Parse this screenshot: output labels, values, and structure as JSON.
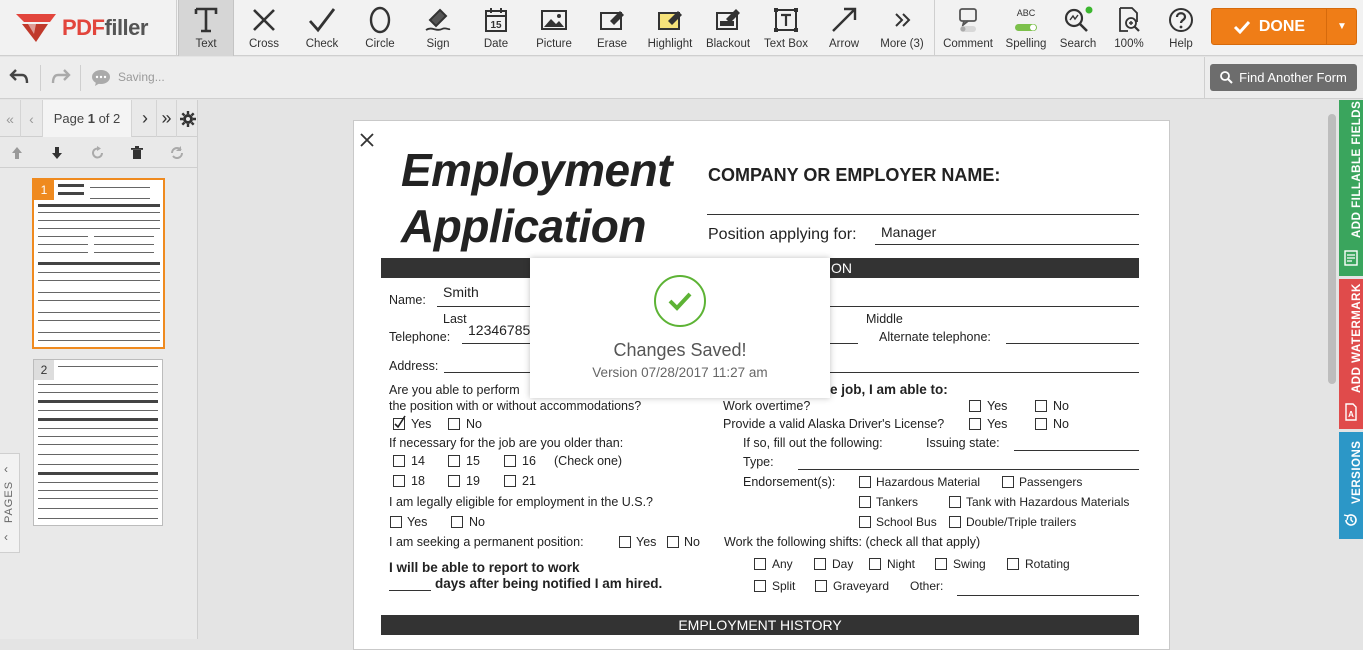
{
  "app": {
    "logo_text_a": "PDF",
    "logo_text_b": "filler"
  },
  "toolbar": {
    "tools": [
      {
        "label": "Text",
        "icon": "text-icon"
      },
      {
        "label": "Cross",
        "icon": "cross-icon"
      },
      {
        "label": "Check",
        "icon": "check-icon"
      },
      {
        "label": "Circle",
        "icon": "circle-icon"
      },
      {
        "label": "Sign",
        "icon": "sign-icon"
      },
      {
        "label": "Date",
        "icon": "date-icon"
      },
      {
        "label": "Picture",
        "icon": "picture-icon"
      },
      {
        "label": "Erase",
        "icon": "erase-icon"
      },
      {
        "label": "Highlight",
        "icon": "highlight-icon"
      },
      {
        "label": "Blackout",
        "icon": "blackout-icon"
      },
      {
        "label": "Text Box",
        "icon": "textbox-icon"
      },
      {
        "label": "Arrow",
        "icon": "arrow-icon"
      },
      {
        "label": "More (3)",
        "icon": "more-icon"
      }
    ],
    "date_icon_number": "15",
    "spelling_badge": "ABC",
    "right_tools": [
      {
        "label": "Comment",
        "icon": "comment-icon"
      },
      {
        "label": "Spelling",
        "icon": "spelling-icon"
      },
      {
        "label": "Search",
        "icon": "search-icon"
      },
      {
        "label": "100%",
        "icon": "zoom-icon"
      },
      {
        "label": "Help",
        "icon": "help-icon"
      }
    ],
    "done_label": "DONE",
    "accent_color": "#ef7d17"
  },
  "subbar": {
    "saving_text": "Saving...",
    "find_form_label": "Find Another Form"
  },
  "pages": {
    "label_prefix": "Page",
    "current": "1",
    "label_mid": "of",
    "total": "2",
    "thumb_1": "1",
    "thumb_2": "2",
    "tab_label": "PAGES"
  },
  "right_tabs": {
    "fillable": "ADD FILLABLE FIELDS",
    "watermark": "ADD WATERMARK",
    "versions": "VERSIONS"
  },
  "document": {
    "title_line1": "Employment",
    "title_line2": "Application",
    "company_label": "COMPANY OR EMPLOYER NAME:",
    "position_label": "Position applying for:",
    "position_value": "Manager",
    "band1_text": "ON",
    "name_label": "Name:",
    "name_value": "Smith",
    "last_label": "Last",
    "middle_label": "Middle",
    "telephone_label": "Telephone:",
    "telephone_value": "12346785",
    "alt_telephone_label": "Alternate telephone:",
    "address_label": "Address:",
    "perform_line1": "Are you able to perform",
    "perform_line2": "the position with or without accommodations?",
    "yes": "Yes",
    "no": "No",
    "job_able_text": "e job, I am able to:",
    "overtime_label": "Work overtime?",
    "license_label": "Provide a valid Alaska Driver's License?",
    "older_label": "If necessary for the job are you older than:",
    "ages_row1": [
      "14",
      "15",
      "16"
    ],
    "check_one": "(Check one)",
    "ages_row2": [
      "18",
      "19",
      "21"
    ],
    "fill_following": "If so, fill out the following:",
    "issuing_state": "Issuing state:",
    "type_label": "Type:",
    "endorsements_label": "Endorsement(s):",
    "endorsements": [
      "Hazardous Material",
      "Passengers",
      "Tankers",
      "Tank with Hazardous Materials",
      "School Bus",
      "Double/Triple trailers"
    ],
    "eligible_label": "I am legally eligible for employment in the U.S.?",
    "permanent_label": "I am seeking a permanent position:",
    "shifts_label": "Work the following shifts: (check all that apply)",
    "shifts": [
      "Any",
      "Day",
      "Night",
      "Swing",
      "Rotating",
      "Split",
      "Graveyard"
    ],
    "other_label": "Other:",
    "report_line1": "I will be able to report to work",
    "report_line2": "days after being notified I am hired.",
    "history_band": "EMPLOYMENT HISTORY"
  },
  "modal": {
    "title": "Changes Saved!",
    "version_text": "Version 07/28/2017 11:27 am",
    "success_color": "#5db335"
  }
}
